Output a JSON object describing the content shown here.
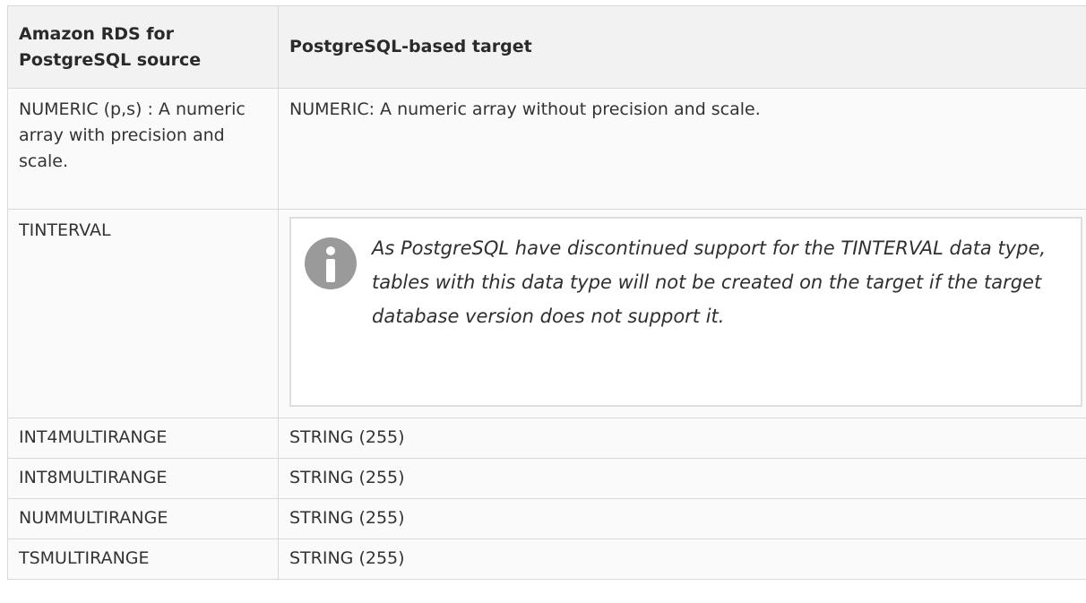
{
  "table": {
    "headers": [
      "Amazon RDS for PostgreSQL source",
      "PostgreSQL-based target"
    ],
    "rows": [
      {
        "source": "NUMERIC (p,s) : A numeric array with precision and scale.",
        "target": "NUMERIC: A numeric array without precision and scale."
      },
      {
        "source": "TINTERVAL",
        "target": ""
      },
      {
        "source": "INT4MULTIRANGE",
        "target": "STRING (255)"
      },
      {
        "source": "INT8MULTIRANGE",
        "target": "STRING (255)"
      },
      {
        "source": "NUMMULTIRANGE",
        "target": "STRING (255)"
      },
      {
        "source": "TSMULTIRANGE",
        "target": "STRING (255)"
      }
    ]
  },
  "note": {
    "icon": "info-icon",
    "icon_color": "#9a9a9a",
    "text": "As PostgreSQL have discontinued support for the TINTERVAL data type, tables with this data type will not be created on the target if the target database version does not support it."
  }
}
